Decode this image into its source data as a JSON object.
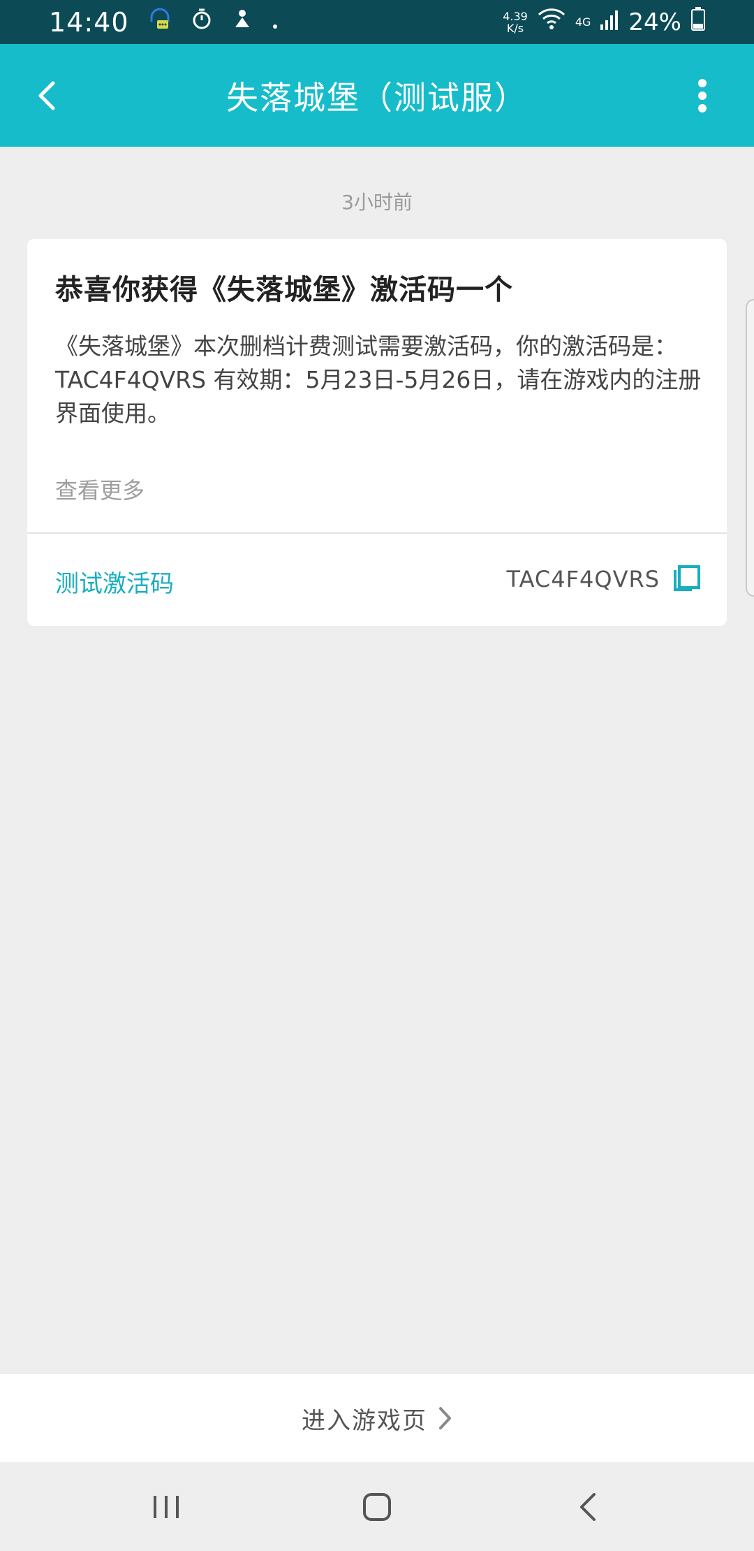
{
  "status_bar": {
    "time": "14:40",
    "net_speed_value": "4.39",
    "net_speed_unit": "K/s",
    "network": "4G",
    "battery": "24%"
  },
  "app_bar": {
    "title": "失落城堡（测试服）"
  },
  "message": {
    "time_ago": "3小时前",
    "title": "恭喜你获得《失落城堡》激活码一个",
    "body": "《失落城堡》本次删档计费测试需要激活码，你的激活码是：TAC4F4QVRS 有效期：5月23日-5月26日，请在游戏内的注册界面使用。",
    "more_label": "查看更多",
    "code_label": "测试激活码",
    "code_value": "TAC4F4QVRS"
  },
  "footer": {
    "enter_label": "进入游戏页"
  },
  "colors": {
    "accent": "#17bccb",
    "status_bar": "#0c4a56",
    "link": "#17aebf"
  }
}
